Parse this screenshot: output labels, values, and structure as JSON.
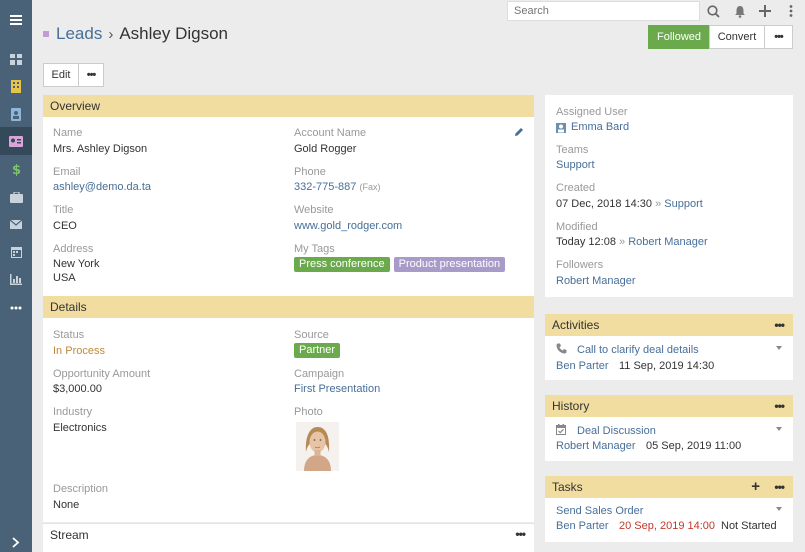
{
  "topbar": {
    "search_placeholder": "Search"
  },
  "header": {
    "scope": "Leads",
    "separator": "›",
    "record_name": "Ashley Digson",
    "buttons": {
      "followed": "Followed",
      "convert": "Convert",
      "more": "•••"
    }
  },
  "actions": {
    "edit": "Edit",
    "more": "•••"
  },
  "overview": {
    "title": "Overview",
    "name_label": "Name",
    "name_value": "Mrs. Ashley Digson",
    "account_label": "Account Name",
    "account_value": "Gold Rogger",
    "email_label": "Email",
    "email_value": "ashley@demo.da.ta",
    "phone_label": "Phone",
    "phone_value": "332-775-887",
    "phone_type": "(Fax)",
    "title_label": "Title",
    "title_value": "CEO",
    "website_label": "Website",
    "website_value": "www.gold_rodger.com",
    "address_label": "Address",
    "address_line1": "New York",
    "address_line2": "USA",
    "tags_label": "My Tags",
    "tags": [
      "Press conference",
      "Product presentation"
    ]
  },
  "details": {
    "title": "Details",
    "status_label": "Status",
    "status_value": "In Process",
    "source_label": "Source",
    "source_value": "Partner",
    "amount_label": "Opportunity Amount",
    "amount_value": "$3,000.00",
    "campaign_label": "Campaign",
    "campaign_value": "First Presentation",
    "industry_label": "Industry",
    "industry_value": "Electronics",
    "photo_label": "Photo",
    "description_label": "Description",
    "description_value": "None"
  },
  "stream": {
    "title": "Stream",
    "more": "•••"
  },
  "side": {
    "assigned_label": "Assigned User",
    "assigned_value": "Emma Bard",
    "teams_label": "Teams",
    "teams_value": "Support",
    "created_label": "Created",
    "created_value": "07 Dec, 2018 14:30",
    "created_sep": "»",
    "created_team": "Support",
    "modified_label": "Modified",
    "modified_value": "Today 12:08",
    "modified_sep": "»",
    "modified_user": "Robert Manager",
    "followers_label": "Followers",
    "followers_value": "Robert Manager"
  },
  "activities": {
    "title": "Activities",
    "more": "•••",
    "item_title": "Call to clarify deal details",
    "item_user": "Ben Parter",
    "item_date": "11 Sep, 2019 14:30"
  },
  "history": {
    "title": "History",
    "more": "•••",
    "item_title": "Deal Discussion",
    "item_user": "Robert Manager",
    "item_date": "05 Sep, 2019 11:00"
  },
  "tasks": {
    "title": "Tasks",
    "add": "+",
    "more": "•••",
    "item_title": "Send Sales Order",
    "item_user": "Ben Parter",
    "item_date": "20 Sep, 2019 14:00",
    "item_status": "Not Started"
  },
  "colors": {
    "nav": "#4a6278",
    "panel_header": "#f1dda0",
    "link": "#476f99",
    "success": "#6aaa4d",
    "tag_green": "#6aaa4d",
    "tag_purple": "#a89bc9",
    "status_orange": "#c0893a",
    "overdue_red": "#c0392b"
  }
}
